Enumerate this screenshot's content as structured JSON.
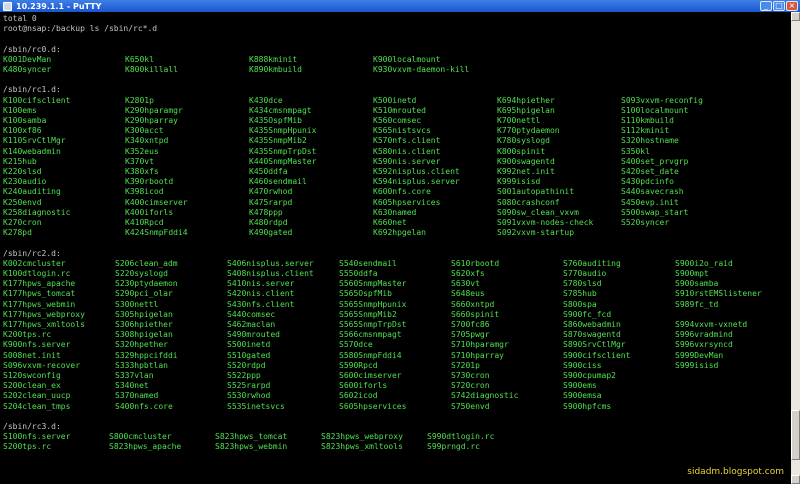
{
  "window": {
    "title": "10.239.1.1 - PuTTY",
    "icon": "putty-icon",
    "buttons": [
      "_",
      "□",
      "×"
    ]
  },
  "terminal": {
    "header_lines": [
      "total 0",
      "root@nsap:/backup ls /sbin/rc*.d"
    ],
    "sections": [
      {
        "heading": "/sbin/rc0.d:",
        "rows": [
          [
            "K001DevMan",
            "K650kl",
            "K888kminit",
            "K900localmount"
          ],
          [
            "K480syncer",
            "K800killall",
            "K890kmbuild",
            "K930vxvm-daemon-kill"
          ]
        ]
      },
      {
        "heading": "/sbin/rc1.d:",
        "rows": [
          [
            "K100cifsclient",
            "K2801p",
            "K430dce",
            "K500inetd",
            "K694hpiether",
            "S093vxvm-reconfig"
          ],
          [
            "K100ems",
            "K290hparamgr",
            "K434cmsnmpagt",
            "K510mrouted",
            "K695hpigelan",
            "S100localmount"
          ],
          [
            "K100samba",
            "K290hparray",
            "K435OspfMib",
            "K560comsec",
            "K700nettl",
            "S110kmbuild"
          ],
          [
            "K100xf86",
            "K300acct",
            "K435SnmpHpunix",
            "K565nistsvcs",
            "K770ptydaemon",
            "S112kminit"
          ],
          [
            "K110SrvCtlMgr",
            "K340xntpd",
            "K435SnmpMib2",
            "K570nfs.client",
            "K780syslogd",
            "S320hostname"
          ],
          [
            "K140webadmin",
            "K352eus",
            "K435SnmpTrpDst",
            "K580nis.client",
            "K800spinit",
            "S350kl"
          ],
          [
            "K215hub",
            "K370vt",
            "K440SnmpMaster",
            "K590nis.server",
            "K900swagentd",
            "S400set_prvgrp"
          ],
          [
            "K220slsd",
            "K380xfs",
            "K450ddfa",
            "K592nisplus.client",
            "K992net.init",
            "S420set_date"
          ],
          [
            "K230audio",
            "K390rbootd",
            "K460sendmail",
            "K594nisplus.server",
            "K999isisd",
            "S430pdcinfo"
          ],
          [
            "K240auditing",
            "K398icod",
            "K470rwhod",
            "K600nfs.core",
            "S001autopathinit",
            "S440savecrash"
          ],
          [
            "K250envd",
            "K400cimserver",
            "K475rarpd",
            "K605hpservices",
            "S080crashconf",
            "S450evp.init"
          ],
          [
            "K258diagnostic",
            "K400iforls",
            "K478ppp",
            "K630named",
            "S090sw_clean_vxvm",
            "S500swap_start"
          ],
          [
            "K270cron",
            "K410Rpcd",
            "K480rdpd",
            "K660net",
            "S091vxvm-nodes-check",
            "S520syncer"
          ],
          [
            "K278pd",
            "K424SnmpFddi4",
            "K490gated",
            "K692hpgelan",
            "S092vxvm-startup",
            ""
          ]
        ]
      },
      {
        "heading": "/sbin/rc2.d:",
        "rows": [
          [
            "K002cmcluster",
            "S206clean_adm",
            "S406nisplus.server",
            "S540sendmail",
            "S610rbootd",
            "S760auditing",
            "S900i2o_raid"
          ],
          [
            "K100dtlogin.rc",
            "S220syslogd",
            "S408nisplus.client",
            "S550ddfa",
            "S620xfs",
            "S770audio",
            "S900mpt"
          ],
          [
            "K177hpws_apache",
            "S230ptydaemon",
            "S410nis.server",
            "S560SnmpMaster",
            "S630vt",
            "S780slsd",
            "S900samba"
          ],
          [
            "K177hpws_tomcat",
            "S290pci_olar",
            "S420nis.client",
            "S565OspfMib",
            "S648eus",
            "S785hub",
            "S910rstEMSlistener"
          ],
          [
            "K177hpws_webmin",
            "S300nettl",
            "S430nfs.client",
            "S565SnmpHpunix",
            "S660xntpd",
            "S800spa",
            "S989fc_td"
          ],
          [
            "K177hpws_webproxy",
            "S305hpigelan",
            "S440comsec",
            "S565SnmpMib2",
            "S660spinit",
            "S900fc_fcd"
          ],
          [
            "K177hpws_xmltools",
            "S306hpiether",
            "S462maclan",
            "S565SnmpTrpDst",
            "S700fc86",
            "S860webadmin",
            "S994vxvm-vxnetd"
          ],
          [
            "K200tps.rc",
            "S308hpigelan",
            "S490mrouted",
            "S566cmsnmpagt",
            "S705pwgr",
            "S870swagentd",
            "S996vradmind"
          ],
          [
            "K900nfs.server",
            "S320hpether",
            "S500inetd",
            "S570dce",
            "S710hparamgr",
            "S890SrvCtlMgr",
            "S996vxrsyncd"
          ],
          [
            "S008net.init",
            "S329hppcifddi",
            "S510gated",
            "S580SnmpFddi4",
            "S710hparray",
            "S900cifsclient",
            "S999DevMan"
          ],
          [
            "S096vxvm-recover",
            "S333hpbtlan",
            "S520rdpd",
            "S590Rpcd",
            "S7201p",
            "S900ciss",
            "S999isisd"
          ],
          [
            "S120swconfig",
            "S337vlan",
            "S522ppp",
            "S600cimserver",
            "S730cron",
            "S900cpumap2",
            ""
          ],
          [
            "S200clean_ex",
            "S340net",
            "S525rarpd",
            "S600iforls",
            "S720cron",
            "S900ems",
            ""
          ],
          [
            "S202clean_uucp",
            "S370named",
            "S530rwhod",
            "S602icod",
            "S742diagnostic",
            "S900emsa",
            ""
          ],
          [
            "S204clean_tmps",
            "S400nfs.core",
            "S535inetsvcs",
            "S605hpservices",
            "S750envd",
            "S900hpfcms",
            ""
          ]
        ]
      },
      {
        "heading": "/sbin/rc3.d:",
        "rows": [
          [
            "S100nfs.server",
            "S800cmcluster",
            "S823hpws_tomcat",
            "S823hpws_webproxy",
            "S990dtlogin.rc"
          ],
          [
            "S200tps.rc",
            "S823hpws_apache",
            "S823hpws_webmin",
            "S823hpws_xmltools",
            "S99prngd.rc"
          ]
        ]
      }
    ]
  },
  "watermark": "sidadm.blogspot.com",
  "colors": {
    "green": "#50e050",
    "plain": "#c6c6c6",
    "background": "#000000",
    "titlebar": "#1a56cc",
    "watermark": "#e8d23a"
  }
}
